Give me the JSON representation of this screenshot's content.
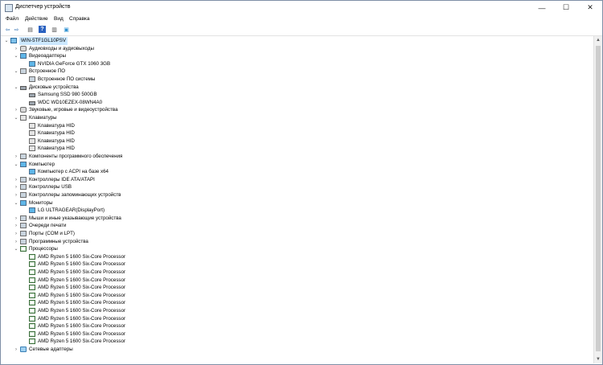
{
  "window": {
    "title": "Диспетчер устройств",
    "controls": {
      "minimize": "—",
      "maximize": "☐",
      "close": "✕"
    }
  },
  "menu": [
    "Файл",
    "Действие",
    "Вид",
    "Справка"
  ],
  "toolbar": {
    "icons": [
      "back-icon",
      "forward-icon",
      "properties-icon",
      "help-icon",
      "view-icon",
      "monitor-scan-icon"
    ],
    "glyphs": [
      "⇦",
      "⇨",
      "▤",
      "?",
      "▥",
      "▣"
    ]
  },
  "tree": [
    {
      "level": 0,
      "exp": "expanded",
      "icon": "computer",
      "label": "WIN-5TF1GL10PSV",
      "root": true
    },
    {
      "level": 1,
      "exp": "collapsed",
      "icon": "audio",
      "label": "Аудиовходы и аудиовыходы"
    },
    {
      "level": 1,
      "exp": "expanded",
      "icon": "monitor",
      "label": "Видеоадаптеры"
    },
    {
      "level": 2,
      "exp": "none",
      "icon": "monitor",
      "label": "NVIDIA GeForce GTX 1060 3GB"
    },
    {
      "level": 1,
      "exp": "expanded",
      "icon": "generic",
      "label": "Встроенное ПО"
    },
    {
      "level": 2,
      "exp": "none",
      "icon": "generic",
      "label": "Встроенное ПО системы"
    },
    {
      "level": 1,
      "exp": "expanded",
      "icon": "disk",
      "label": "Дисковые устройства"
    },
    {
      "level": 2,
      "exp": "none",
      "icon": "disk",
      "label": "Samsung SSD 980 500GB"
    },
    {
      "level": 2,
      "exp": "none",
      "icon": "disk",
      "label": "WDC WD10EZEX-08WN4A0"
    },
    {
      "level": 1,
      "exp": "collapsed",
      "icon": "audio",
      "label": "Звуковые, игровые и видеоустройства"
    },
    {
      "level": 1,
      "exp": "expanded",
      "icon": "keyboard",
      "label": "Клавиатуры"
    },
    {
      "level": 2,
      "exp": "none",
      "icon": "keyboard",
      "label": "Клавиатура HID"
    },
    {
      "level": 2,
      "exp": "none",
      "icon": "keyboard",
      "label": "Клавиатура HID"
    },
    {
      "level": 2,
      "exp": "none",
      "icon": "keyboard",
      "label": "Клавиатура HID"
    },
    {
      "level": 2,
      "exp": "none",
      "icon": "keyboard",
      "label": "Клавиатура HID"
    },
    {
      "level": 1,
      "exp": "collapsed",
      "icon": "generic",
      "label": "Компоненты программного обеспечения"
    },
    {
      "level": 1,
      "exp": "expanded",
      "icon": "monitor",
      "label": "Компьютер"
    },
    {
      "level": 2,
      "exp": "none",
      "icon": "monitor",
      "label": "Компьютер с ACPI на базе x64"
    },
    {
      "level": 1,
      "exp": "collapsed",
      "icon": "generic",
      "label": "Контроллеры IDE ATA/ATAPI"
    },
    {
      "level": 1,
      "exp": "collapsed",
      "icon": "generic",
      "label": "Контроллеры USB"
    },
    {
      "level": 1,
      "exp": "collapsed",
      "icon": "generic",
      "label": "Контроллеры запоминающих устройств"
    },
    {
      "level": 1,
      "exp": "expanded",
      "icon": "monitor",
      "label": "Мониторы"
    },
    {
      "level": 2,
      "exp": "none",
      "icon": "monitor",
      "label": "LG ULTRAGEAR(DisplayPort)"
    },
    {
      "level": 1,
      "exp": "collapsed",
      "icon": "generic",
      "label": "Мыши и иные указывающие устройства"
    },
    {
      "level": 1,
      "exp": "collapsed",
      "icon": "generic",
      "label": "Очереди печати"
    },
    {
      "level": 1,
      "exp": "collapsed",
      "icon": "generic",
      "label": "Порты (COM и LPT)"
    },
    {
      "level": 1,
      "exp": "collapsed",
      "icon": "generic",
      "label": "Программные устройства"
    },
    {
      "level": 1,
      "exp": "expanded",
      "icon": "cpu",
      "label": "Процессоры"
    },
    {
      "level": 2,
      "exp": "none",
      "icon": "cpu",
      "label": "AMD Ryzen 5 1600 Six-Core Processor"
    },
    {
      "level": 2,
      "exp": "none",
      "icon": "cpu",
      "label": "AMD Ryzen 5 1600 Six-Core Processor"
    },
    {
      "level": 2,
      "exp": "none",
      "icon": "cpu",
      "label": "AMD Ryzen 5 1600 Six-Core Processor"
    },
    {
      "level": 2,
      "exp": "none",
      "icon": "cpu",
      "label": "AMD Ryzen 5 1600 Six-Core Processor"
    },
    {
      "level": 2,
      "exp": "none",
      "icon": "cpu",
      "label": "AMD Ryzen 5 1600 Six-Core Processor"
    },
    {
      "level": 2,
      "exp": "none",
      "icon": "cpu",
      "label": "AMD Ryzen 5 1600 Six-Core Processor"
    },
    {
      "level": 2,
      "exp": "none",
      "icon": "cpu",
      "label": "AMD Ryzen 5 1600 Six-Core Processor"
    },
    {
      "level": 2,
      "exp": "none",
      "icon": "cpu",
      "label": "AMD Ryzen 5 1600 Six-Core Processor"
    },
    {
      "level": 2,
      "exp": "none",
      "icon": "cpu",
      "label": "AMD Ryzen 5 1600 Six-Core Processor"
    },
    {
      "level": 2,
      "exp": "none",
      "icon": "cpu",
      "label": "AMD Ryzen 5 1600 Six-Core Processor"
    },
    {
      "level": 2,
      "exp": "none",
      "icon": "cpu",
      "label": "AMD Ryzen 5 1600 Six-Core Processor"
    },
    {
      "level": 2,
      "exp": "none",
      "icon": "cpu",
      "label": "AMD Ryzen 5 1600 Six-Core Processor"
    },
    {
      "level": 1,
      "exp": "collapsed",
      "icon": "network",
      "label": "Сетевые адаптеры"
    }
  ],
  "colors": {
    "selection": "#cce8ff",
    "border": "#7f8fa6"
  }
}
